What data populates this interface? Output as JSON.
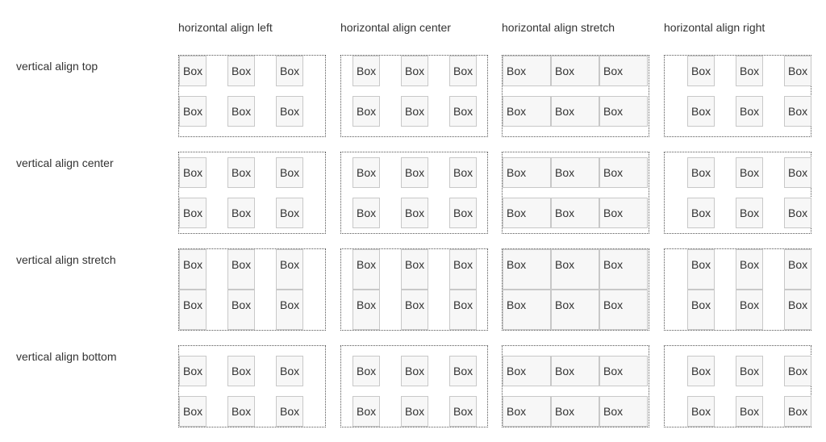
{
  "columns": [
    {
      "label": "horizontal align left",
      "mode": "left"
    },
    {
      "label": "horizontal align center",
      "mode": "center"
    },
    {
      "label": "horizontal align stretch",
      "mode": "stretch"
    },
    {
      "label": "horizontal align right",
      "mode": "right"
    }
  ],
  "rows": [
    {
      "label": "vertical align top",
      "mode": "top"
    },
    {
      "label": "vertical align center",
      "mode": "center"
    },
    {
      "label": "vertical align stretch",
      "mode": "stretch"
    },
    {
      "label": "vertical align bottom",
      "mode": "bottom"
    }
  ],
  "grid": {
    "cols": 3,
    "rows": 2
  },
  "box_label": "Box",
  "colors": {
    "text": "#333333",
    "box_border": "#c8c8c8",
    "box_fill": "#f7f7f7",
    "grid_border": "#555555"
  }
}
